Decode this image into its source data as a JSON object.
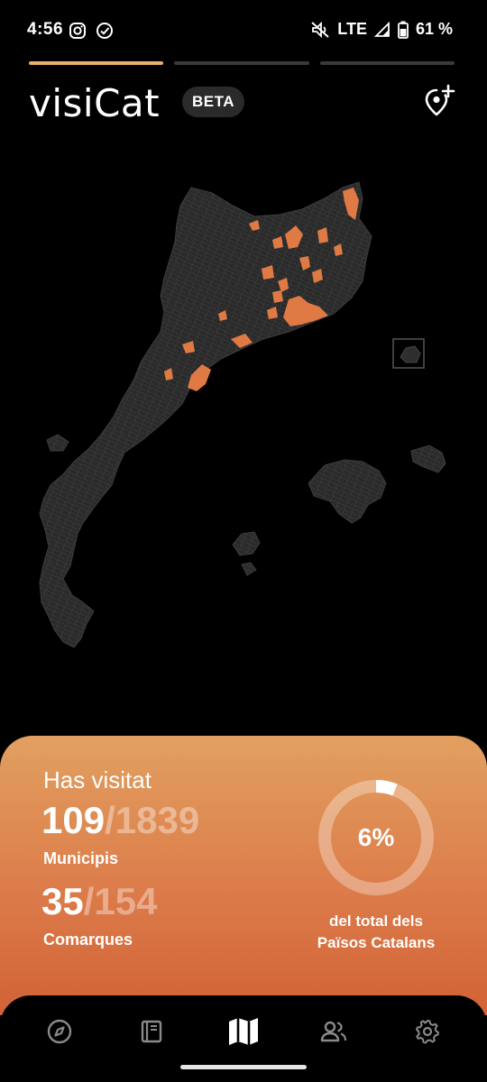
{
  "status_bar": {
    "time": "4:56",
    "network": "LTE",
    "battery": "61 %",
    "icons": [
      "instagram-icon",
      "check-circle-icon",
      "mute-icon",
      "signal-icon",
      "battery-icon"
    ]
  },
  "story_progress": {
    "segments": 3,
    "active_index": 0
  },
  "header": {
    "logo_text": "visiCat",
    "badge": "BETA",
    "add_place_icon": "map-pin-plus-icon"
  },
  "map": {
    "visited_color": "#e07a45",
    "land_color": "#2a2a2a",
    "border_color": "#3c3c3c"
  },
  "stats": {
    "title": "Has visitat",
    "municipis": {
      "visited": "109",
      "total": "/1839",
      "label": "Municipis"
    },
    "comarques": {
      "visited": "35",
      "total": "/154",
      "label": "Comarques"
    },
    "percentage_text": "6%",
    "percentage": 0.06,
    "caption_line1": "del total dels",
    "caption_line2": "Països Catalans"
  },
  "nav": {
    "items": [
      {
        "icon": "compass-icon",
        "active": false
      },
      {
        "icon": "book-icon",
        "active": false
      },
      {
        "icon": "map-icon",
        "active": true
      },
      {
        "icon": "people-icon",
        "active": false
      },
      {
        "icon": "settings-icon",
        "active": false
      }
    ]
  },
  "colors": {
    "accent": "#e7b16c",
    "card_top": "#e2a060",
    "card_bottom": "#d26236"
  }
}
